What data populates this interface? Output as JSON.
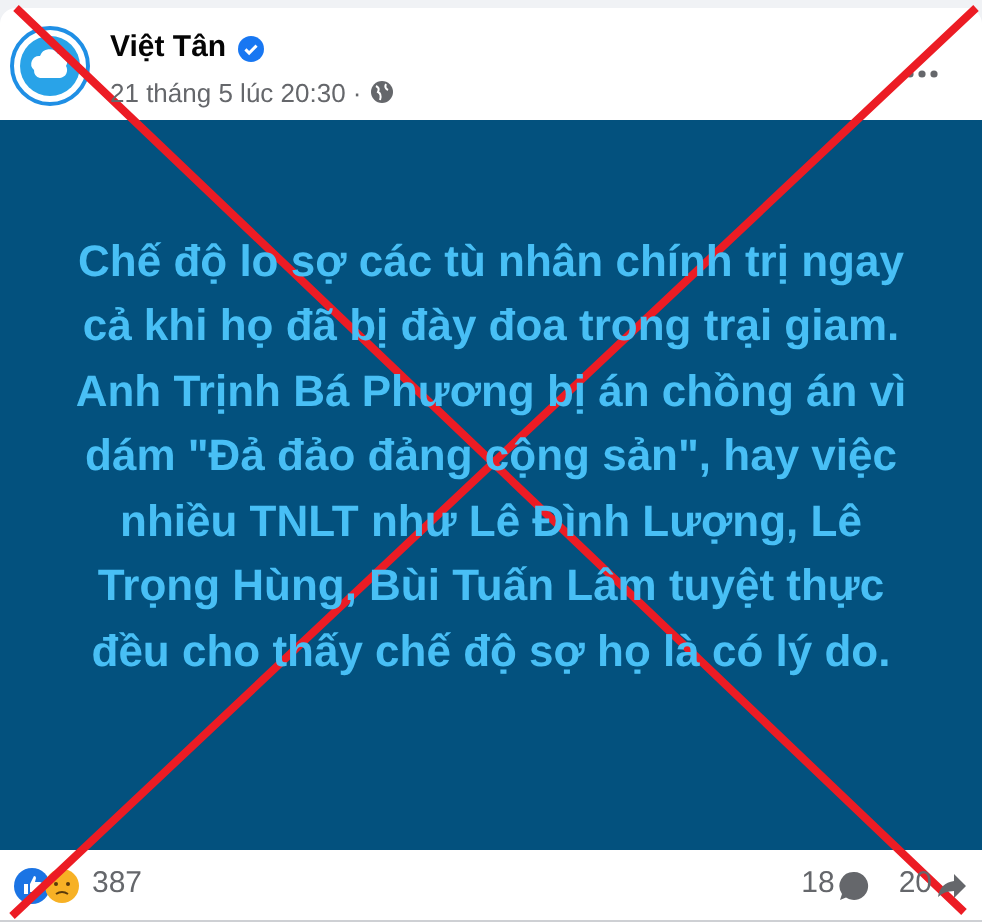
{
  "post": {
    "author": "Việt Tân",
    "verified": true,
    "time": "21 tháng 5 lúc 20:30 ·",
    "text": "Chế độ lo sợ các tù nhân chính trị ngay cả khi họ đã bị đày đoa trong trại giam. Anh Trịnh Bá Phương bị án chồng án vì dám \"Đả đảo đảng cộng sản\", hay việc nhiều TNLT như Lê Đình Lượng, Lê Trọng Hùng, Bùi Tuấn Lâm tuyệt thực đều cho thấy chế độ sợ họ là có lý do.",
    "reactions": "387",
    "comments": "18",
    "shares": "20"
  }
}
